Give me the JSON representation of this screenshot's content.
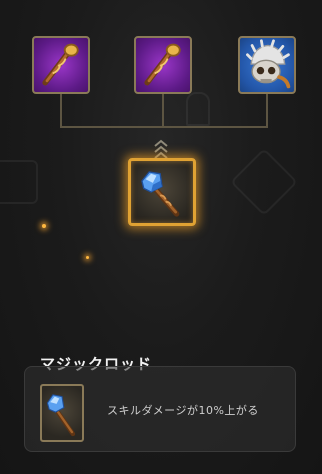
{
  "recipe": {
    "materials": [
      {
        "name": "staff-1",
        "rarity_color": "#7a2aa8",
        "icon": "wooden-staff-icon"
      },
      {
        "name": "staff-2",
        "rarity_color": "#7a2aa8",
        "icon": "wooden-staff-icon"
      },
      {
        "name": "skull-helmet",
        "rarity_color": "#2a62b8",
        "icon": "skull-helmet-icon"
      }
    ],
    "result": {
      "icon": "magic-rod-icon",
      "glow_color": "#e0a233"
    }
  },
  "item": {
    "title": "マジックロッド",
    "description": "スキルダメージが10%上がる",
    "icon": "magic-rod-icon"
  }
}
